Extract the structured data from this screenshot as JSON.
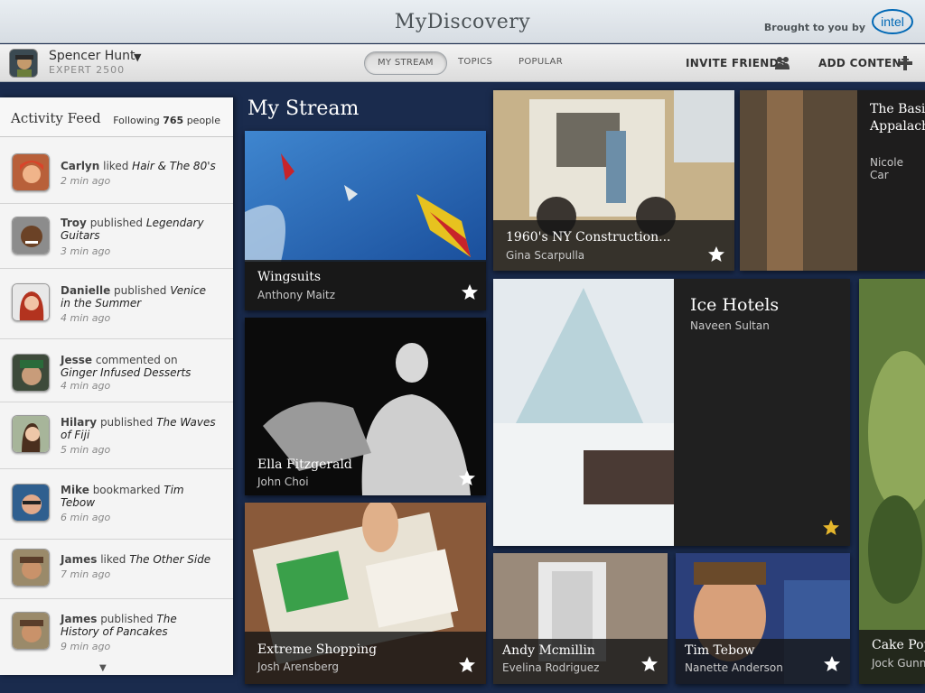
{
  "app": {
    "title": "MyDiscovery",
    "brought_by": "Brought to you by",
    "sponsor": "intel"
  },
  "user": {
    "name": "Spencer Hunt",
    "level": "EXPERT 2500"
  },
  "nav": {
    "tabs": [
      {
        "label": "MY STREAM",
        "active": true
      },
      {
        "label": "TOPICS",
        "active": false
      },
      {
        "label": "POPULAR",
        "active": false
      }
    ],
    "invite_label": "INVITE FRIENDS",
    "add_label": "ADD CONTENT"
  },
  "feed": {
    "title": "Activity Feed",
    "following_prefix": "Following",
    "following_count": "765",
    "following_suffix": "people",
    "items": [
      {
        "who": "Carlyn",
        "action": "liked",
        "what": "Hair & The 80's",
        "time": "2 min ago"
      },
      {
        "who": "Troy",
        "action": "published",
        "what": "Legendary Guitars",
        "time": "3 min ago"
      },
      {
        "who": "Danielle",
        "action": "published",
        "what": "Venice in the Summer",
        "time": "4 min ago"
      },
      {
        "who": "Jesse",
        "action": "commented on",
        "what": "Ginger Infused Desserts",
        "time": "4 min ago"
      },
      {
        "who": "Hilary",
        "action": "published",
        "what": "The Waves of Fiji",
        "time": "5 min ago"
      },
      {
        "who": "Mike",
        "action": "bookmarked",
        "what": "Tim Tebow",
        "time": "6 min ago"
      },
      {
        "who": "James",
        "action": "liked",
        "what": "The Other Side",
        "time": "7 min ago"
      },
      {
        "who": "James",
        "action": "published",
        "what": "The History of Pancakes",
        "time": "9 min ago"
      }
    ]
  },
  "stream": {
    "title": "My Stream",
    "tiles": [
      {
        "title": "Wingsuits",
        "author": "Anthony Maitz"
      },
      {
        "title": "Ella Fitzgerald",
        "author": "John Choi"
      },
      {
        "title": "Extreme Shopping",
        "author": "Josh Arensberg"
      },
      {
        "title": "1960's NY Construction...",
        "author": "Gina Scarpulla"
      },
      {
        "title": "The Basics of the Appalachian Trail",
        "author": "Nicole Car"
      },
      {
        "title": "Ice Hotels",
        "author": "Naveen Sultan",
        "starred": true
      },
      {
        "title": "Andy Mcmillin",
        "author": "Evelina Rodriguez"
      },
      {
        "title": "Tim Tebow",
        "author": "Nanette Anderson"
      },
      {
        "title": "Cake Pop",
        "author": "Jock Gunn"
      }
    ]
  },
  "colors": {
    "background": "#1a2b4d",
    "star_active": "#e5b62c",
    "star_inactive": "#ffffff",
    "sponsor_blue": "#0068b5"
  }
}
